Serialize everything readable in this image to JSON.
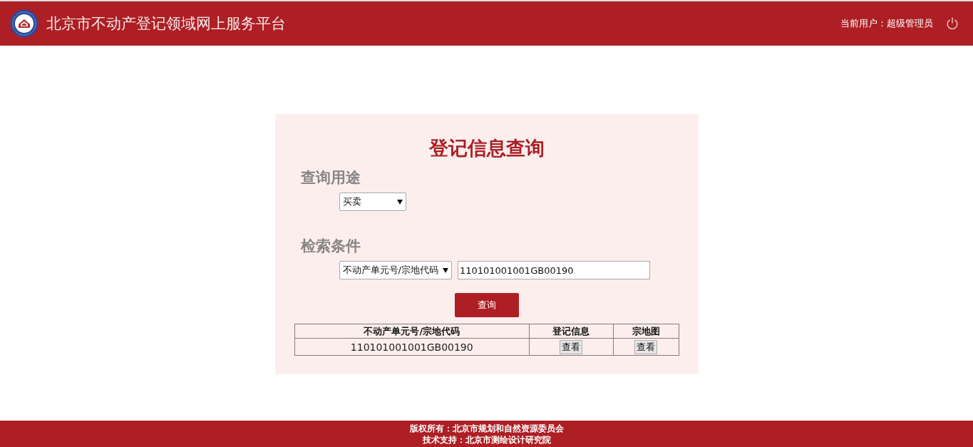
{
  "header": {
    "title": "北京市不动产登记领域网上服务平台",
    "user_label": "当前用户：超级管理员"
  },
  "form": {
    "title": "登记信息查询",
    "sections": [
      {
        "heading": "查询用途",
        "fields": [
          {
            "kind": "select",
            "value": "买卖"
          }
        ]
      },
      {
        "heading": "检索条件",
        "fields": [
          {
            "kind": "select",
            "value": "不动产单元号/宗地代码"
          },
          {
            "kind": "input",
            "value": "110101001001GB00190"
          }
        ]
      }
    ],
    "submit": "查询"
  },
  "table": {
    "columns": [
      "不动产单元号/宗地代码",
      "登记信息",
      "宗地图"
    ],
    "rows": [
      [
        {
          "kind": "text",
          "text": "110101001001GB00190"
        },
        {
          "kind": "button",
          "text": "查看"
        },
        {
          "kind": "button",
          "text": "查看"
        }
      ]
    ]
  },
  "footer": {
    "lines": [
      "版权所有：北京市规划和自然资源委员会",
      "技术支持：北京市测绘设计研究院"
    ]
  }
}
